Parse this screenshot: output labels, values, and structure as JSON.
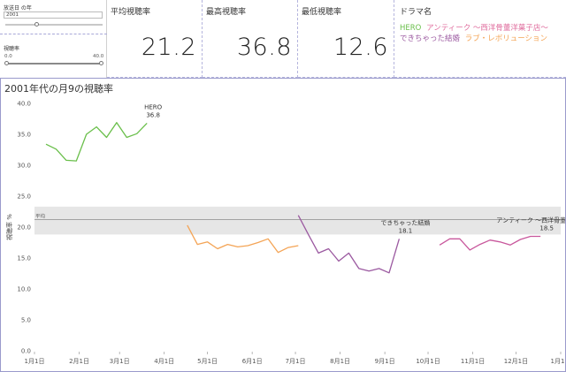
{
  "filters": {
    "year_label": "放送日 の年",
    "year_value": "2001",
    "year_slider_value": 0.33,
    "rating_label": "視聴率",
    "rating_min": "0.0",
    "rating_max": "40.0",
    "rating_range": [
      0.0,
      40.0
    ]
  },
  "kpis": [
    {
      "title": "平均視聴率",
      "value": "21.2"
    },
    {
      "title": "最高視聴率",
      "value": "36.8"
    },
    {
      "title": "最低視聴率",
      "value": "12.6"
    }
  ],
  "dramas": {
    "title": "ドラマ名",
    "items": [
      {
        "name": "HERO",
        "color": "#6abf4b"
      },
      {
        "name": "アンティーク 〜西洋骨董洋菓子店〜",
        "color": "#e06f9f"
      },
      {
        "name": "できちゃった結婚",
        "color": "#9b59a0"
      },
      {
        "name": "ラブ・レボリューション",
        "color": "#f4a455"
      }
    ]
  },
  "chart_data": {
    "type": "line",
    "title": "2001年代の月9の視聴率",
    "ylabel": "視聴率 %",
    "xlabel": "",
    "ylim": [
      0,
      40
    ],
    "yticks": [
      "0.0",
      "5.0",
      "10.0",
      "15.0",
      "20.0",
      "25.0",
      "30.0",
      "35.0",
      "40.0"
    ],
    "xticks": [
      "1月1日",
      "2月1日",
      "3月1日",
      "4月1日",
      "5月1日",
      "6月1日",
      "7月1日",
      "8月1日",
      "9月1日",
      "10月1日",
      "11月1日",
      "12月1日",
      "1月1日"
    ],
    "grid": false,
    "reference": {
      "label": "平均",
      "value": 21.2,
      "band": [
        18.8,
        23.3
      ]
    },
    "series": [
      {
        "name": "HERO",
        "color": "#6abf4b",
        "x": [
          8,
          15,
          22,
          29,
          36,
          43,
          50,
          57,
          64,
          71,
          78
        ],
        "y": [
          33.4,
          32.6,
          30.8,
          30.7,
          35.0,
          36.2,
          34.5,
          36.9,
          34.5,
          35.1,
          36.8
        ],
        "label": {
          "name": "HERO",
          "value": "36.8"
        }
      },
      {
        "name": "ラブ・レボリューション",
        "color": "#f4a455",
        "x": [
          106,
          113,
          120,
          127,
          134,
          141,
          148,
          155,
          162,
          169,
          176,
          183
        ],
        "y": [
          20.3,
          17.2,
          17.6,
          16.5,
          17.2,
          16.8,
          17.0,
          17.5,
          18.1,
          15.9,
          16.7,
          17.0
        ]
      },
      {
        "name": "できちゃった結婚",
        "color": "#9b59a0",
        "x": [
          183,
          190,
          197,
          204,
          211,
          218,
          225,
          232,
          239,
          246,
          253
        ],
        "y": [
          21.9,
          18.8,
          15.8,
          16.5,
          14.5,
          15.8,
          13.3,
          12.9,
          13.3,
          12.6,
          18.1
        ],
        "label": {
          "name": "できちゃった結婚",
          "value": "18.1"
        }
      },
      {
        "name": "アンティーク 〜西洋骨董洋菓子店〜",
        "color": "#c8579c",
        "x": [
          281,
          288,
          295,
          302,
          309,
          316,
          323,
          330,
          337,
          344,
          351
        ],
        "y": [
          17.1,
          18.1,
          18.1,
          16.3,
          17.2,
          17.9,
          17.6,
          17.1,
          18.0,
          18.5,
          18.5
        ],
        "label": {
          "name": "アンティーク 〜西洋骨董洋菓子店〜",
          "value": "18.5"
        }
      }
    ]
  }
}
